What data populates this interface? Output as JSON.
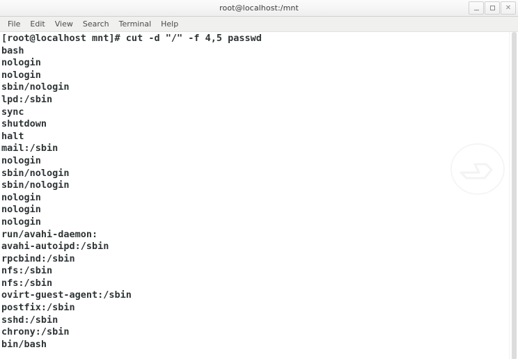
{
  "window": {
    "title": "root@localhost:/mnt",
    "buttons": [
      {
        "name": "minimize",
        "label": "_"
      },
      {
        "name": "maximize",
        "label": "□"
      },
      {
        "name": "close",
        "label": "×"
      }
    ]
  },
  "menubar": {
    "items": [
      {
        "label": "File"
      },
      {
        "label": "Edit"
      },
      {
        "label": "View"
      },
      {
        "label": "Search"
      },
      {
        "label": "Terminal"
      },
      {
        "label": "Help"
      }
    ]
  },
  "terminal": {
    "prompt": "[root@localhost mnt]#",
    "command": "cut -d \"/\" -f 4,5 passwd",
    "lines": [
      "[root@localhost mnt]# cut -d \"/\" -f 4,5 passwd",
      "bash",
      "nologin",
      "nologin",
      "sbin/nologin",
      "lpd:/sbin",
      "sync",
      "shutdown",
      "halt",
      "mail:/sbin",
      "nologin",
      "sbin/nologin",
      "sbin/nologin",
      "nologin",
      "nologin",
      "nologin",
      "run/avahi-daemon:",
      "avahi-autoipd:/sbin",
      "rpcbind:/sbin",
      "nfs:/sbin",
      "nfs:/sbin",
      "ovirt-guest-agent:/sbin",
      "postfix:/sbin",
      "sshd:/sbin",
      "chrony:/sbin",
      "bin/bash"
    ],
    "colors": {
      "background": "#ffffff",
      "foreground": "#2e3436"
    }
  }
}
